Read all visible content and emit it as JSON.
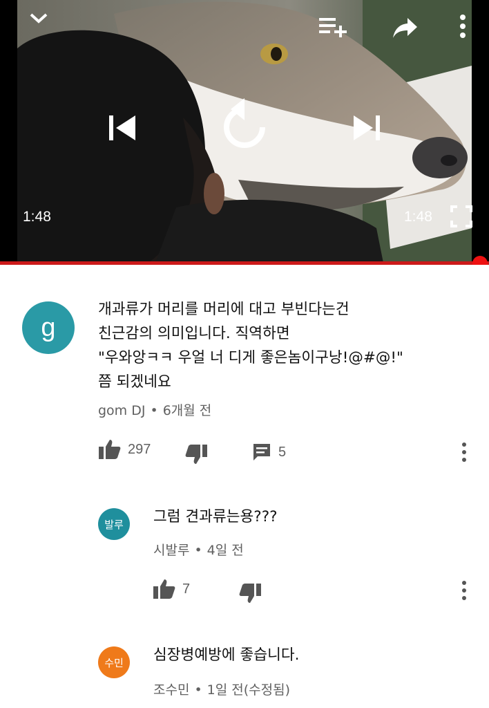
{
  "player": {
    "current_time": "1:48",
    "duration": "1:48",
    "progress": 1.0,
    "accent_color": "#e11",
    "icons": [
      "chevron-down-icon",
      "add-to-queue-icon",
      "share-icon",
      "more-vert-icon",
      "previous-icon",
      "replay-icon",
      "next-icon",
      "fullscreen-icon"
    ]
  },
  "comments": [
    {
      "avatar_letter": "g",
      "avatar_color": "#2a9aa6",
      "text": "개과류가 머리를 머리에 대고 부빈다는건\n친근감의 의미입니다. 직역하면\n\"우와앙ㅋㅋ 우얼 너 디게 좋은놈이구낭!@#@!\"\n쯤 되겠네요",
      "author": "gom DJ",
      "time": "6개월 전",
      "likes": "297",
      "replies": "5"
    }
  ],
  "replies": [
    {
      "avatar_label": "발루",
      "avatar_color": "#1f8f9d",
      "text": "그럼 견과류는용???",
      "author": "시발루",
      "time": "4일 전",
      "likes": "7"
    },
    {
      "avatar_label": "수민",
      "avatar_color": "#ef7a1a",
      "text": "심장병예방에 좋습니다.",
      "author": "조수민",
      "time": "1일 전(수정됨)"
    }
  ]
}
